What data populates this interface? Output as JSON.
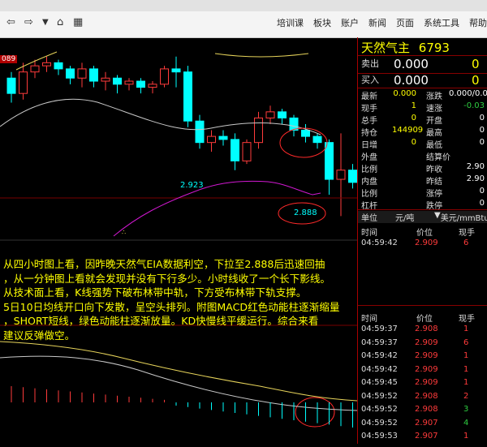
{
  "toolbar": {
    "menu": [
      "培训课",
      "板块",
      "账户",
      "新闻",
      "页面",
      "系统工具",
      "帮助"
    ]
  },
  "chart": {
    "left_price": "089",
    "low_label": "2.923",
    "low_label2": "2.888",
    "candles": [
      {
        "o": 2.933,
        "c": 2.928,
        "h": 2.935,
        "l": 2.925
      },
      {
        "o": 2.928,
        "c": 2.935,
        "h": 2.938,
        "l": 2.926
      },
      {
        "o": 2.935,
        "c": 2.937,
        "h": 2.939,
        "l": 2.933
      },
      {
        "o": 2.937,
        "c": 2.938,
        "h": 2.94,
        "l": 2.935
      },
      {
        "o": 2.938,
        "c": 2.936,
        "h": 2.939,
        "l": 2.934
      },
      {
        "o": 2.936,
        "c": 2.933,
        "h": 2.937,
        "l": 2.931
      },
      {
        "o": 2.933,
        "c": 2.936,
        "h": 2.938,
        "l": 2.93
      },
      {
        "o": 2.936,
        "c": 2.932,
        "h": 2.937,
        "l": 2.93
      },
      {
        "o": 2.932,
        "c": 2.933,
        "h": 2.935,
        "l": 2.929
      },
      {
        "o": 2.933,
        "c": 2.931,
        "h": 2.934,
        "l": 2.928
      },
      {
        "o": 2.931,
        "c": 2.932,
        "h": 2.933,
        "l": 2.929
      },
      {
        "o": 2.932,
        "c": 2.93,
        "h": 2.933,
        "l": 2.928
      },
      {
        "o": 2.93,
        "c": 2.931,
        "h": 2.932,
        "l": 2.928
      },
      {
        "o": 2.931,
        "c": 2.936,
        "h": 2.937,
        "l": 2.93
      },
      {
        "o": 2.936,
        "c": 2.935,
        "h": 2.94,
        "l": 2.93
      },
      {
        "o": 2.935,
        "c": 2.919,
        "h": 2.937,
        "l": 2.917
      },
      {
        "o": 2.919,
        "c": 2.912,
        "h": 2.921,
        "l": 2.91
      },
      {
        "o": 2.912,
        "c": 2.914,
        "h": 2.916,
        "l": 2.909
      },
      {
        "o": 2.914,
        "c": 2.913,
        "h": 2.916,
        "l": 2.911
      },
      {
        "o": 2.913,
        "c": 2.906,
        "h": 2.915,
        "l": 2.903
      },
      {
        "o": 2.906,
        "c": 2.912,
        "h": 2.913,
        "l": 2.905
      },
      {
        "o": 2.912,
        "c": 2.92,
        "h": 2.922,
        "l": 2.91
      },
      {
        "o": 2.92,
        "c": 2.922,
        "h": 2.924,
        "l": 2.918
      },
      {
        "o": 2.922,
        "c": 2.92,
        "h": 2.923,
        "l": 2.918
      },
      {
        "o": 2.92,
        "c": 2.916,
        "h": 2.921,
        "l": 2.914
      },
      {
        "o": 2.916,
        "c": 2.914,
        "h": 2.918,
        "l": 2.912
      },
      {
        "o": 2.914,
        "c": 2.912,
        "h": 2.915,
        "l": 2.91
      },
      {
        "o": 2.912,
        "c": 2.9,
        "h": 2.913,
        "l": 2.895
      },
      {
        "o": 2.9,
        "c": 2.903,
        "h": 2.915,
        "l": 2.888
      },
      {
        "o": 2.903,
        "c": 2.899,
        "h": 2.905,
        "l": 2.897
      }
    ]
  },
  "annotation": {
    "lines": [
      "从四小时图上看，因昨晚天然气EIA数据利空，下拉至2.888后迅速回抽",
      "，从一分钟图上看就会发现并没有下行多少。小时线收了一个长下影线。",
      "从技术面上看，K线强势下破布林带中轨，下方受布林带下轨支撑。",
      "5日10日均线开口向下发散，呈空头排列。附图MACD红色动能柱逐渐缩量",
      "，SHORT短线，绿色动能柱逐渐放量。KD快慢线平缓运行。综合来看",
      "建议反弹做空。"
    ]
  },
  "panel": {
    "title": "天然气主",
    "code": "6793",
    "ask_label": "卖出",
    "ask_price": "0.000",
    "ask_vol": "0",
    "bid_label": "买入",
    "bid_price": "0.000",
    "bid_vol": "0",
    "stats_left": [
      {
        "label": "最新",
        "value": "0.000"
      },
      {
        "label": "现手",
        "value": "1"
      },
      {
        "label": "总手",
        "value": "0"
      },
      {
        "label": "持仓",
        "value": "144909"
      },
      {
        "label": "日增",
        "value": "0"
      },
      {
        "label": "外盘",
        "value": ""
      },
      {
        "label": "比例",
        "value": ""
      },
      {
        "label": "内盘",
        "value": ""
      },
      {
        "label": "比例",
        "value": ""
      },
      {
        "label": "杠杆",
        "value": ""
      }
    ],
    "stats_right": [
      {
        "label": "涨跌",
        "value": "0.000/0.0"
      },
      {
        "label": "速涨",
        "value": "-0.03"
      },
      {
        "label": "开盘",
        "value": "0"
      },
      {
        "label": "最高",
        "value": "0"
      },
      {
        "label": "最低",
        "value": "0"
      },
      {
        "label": "结算价",
        "value": ""
      },
      {
        "label": "昨收",
        "value": "2.90"
      },
      {
        "label": "昨结",
        "value": "2.90"
      },
      {
        "label": "涨停",
        "value": "0"
      },
      {
        "label": "跌停",
        "value": "0"
      }
    ],
    "unit_label": "单位",
    "unit_value": "元/吨",
    "currency": "美元/mmBtu",
    "trades_header": [
      "时间",
      "价位",
      "现手"
    ],
    "trades_top": [
      {
        "time": "04:59:42",
        "price": "2.909",
        "vol": "6"
      }
    ],
    "trades_bottom": [
      {
        "time": "04:59:37",
        "price": "2.908",
        "vol": "1"
      },
      {
        "time": "04:59:37",
        "price": "2.909",
        "vol": "6"
      },
      {
        "time": "04:59:42",
        "price": "2.909",
        "vol": "1"
      },
      {
        "time": "04:59:42",
        "price": "2.909",
        "vol": "1"
      },
      {
        "time": "04:59:45",
        "price": "2.909",
        "vol": "1"
      },
      {
        "time": "04:59:52",
        "price": "2.908",
        "vol": "2"
      },
      {
        "time": "04:59:52",
        "price": "2.908",
        "vol": "3"
      },
      {
        "time": "04:59:52",
        "price": "2.907",
        "vol": "4"
      },
      {
        "time": "04:59:53",
        "price": "2.907",
        "vol": "1"
      }
    ]
  }
}
